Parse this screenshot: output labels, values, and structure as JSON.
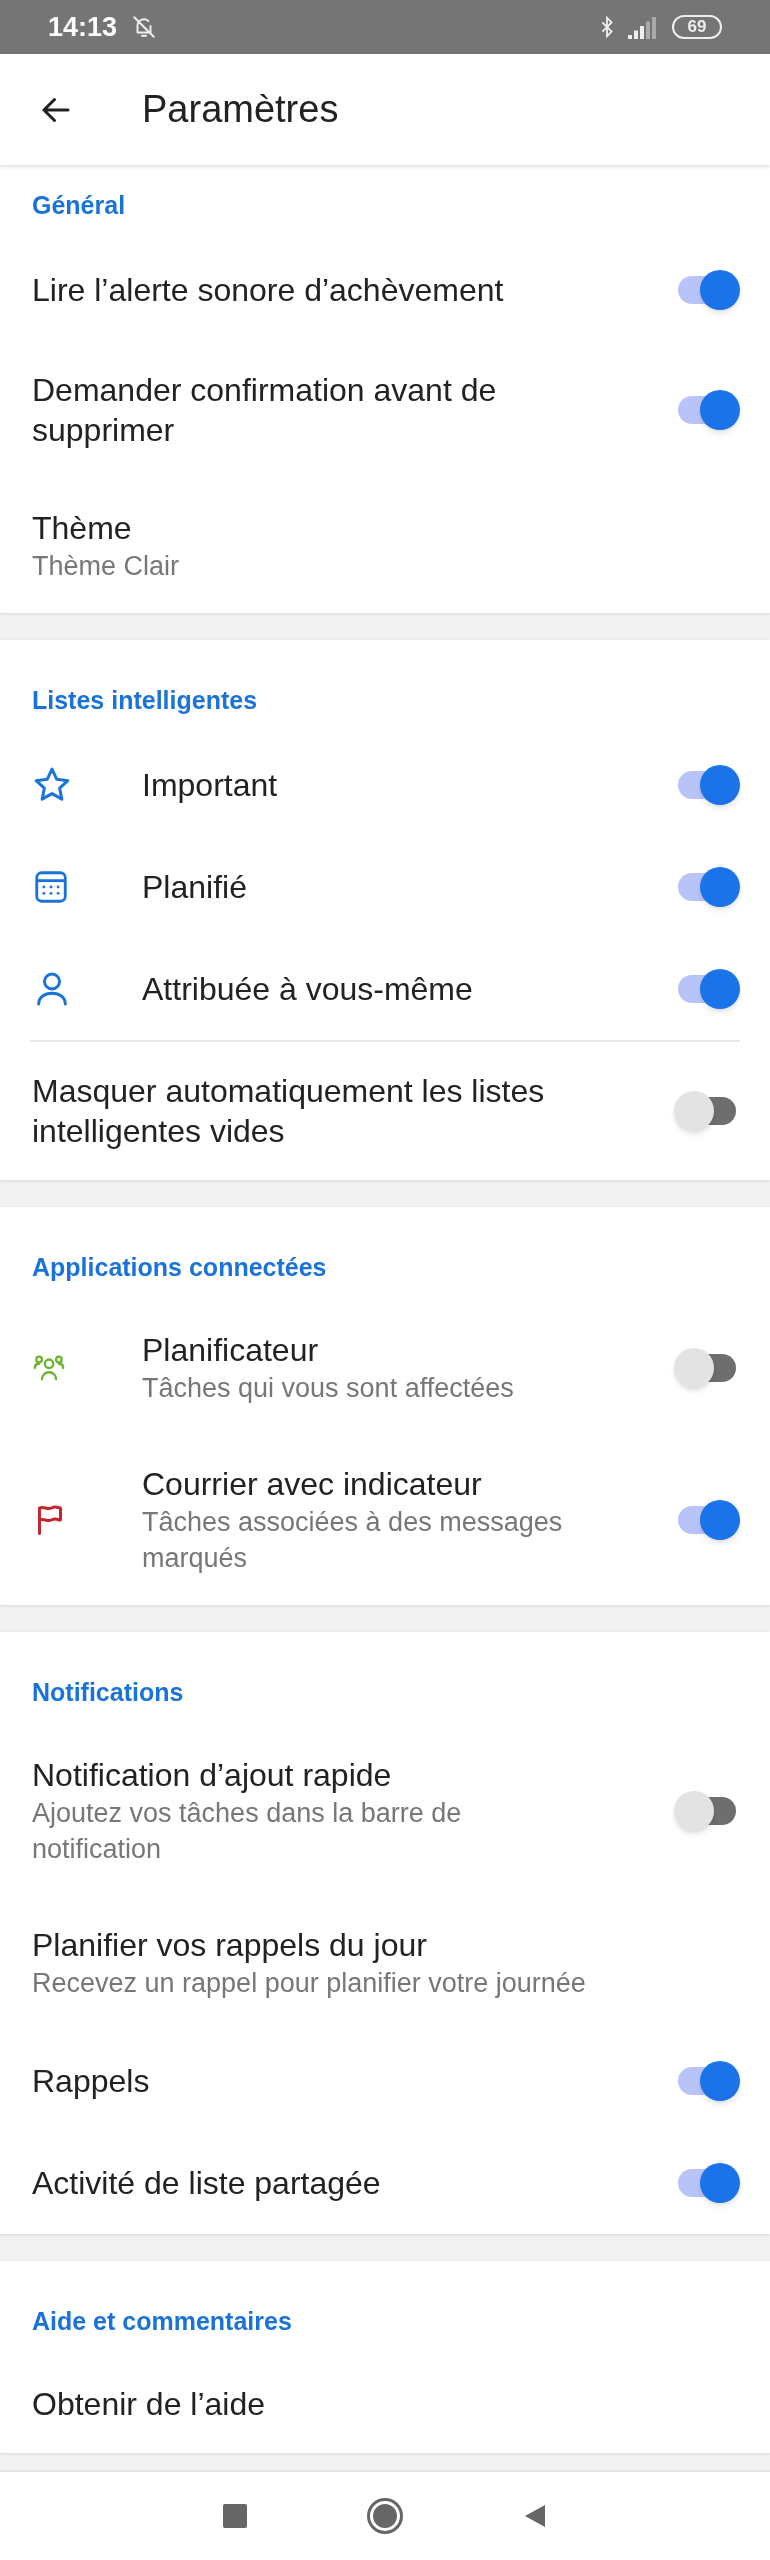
{
  "status_bar": {
    "time": "14:13",
    "battery": "69"
  },
  "app_bar": {
    "title": "Paramètres"
  },
  "sections": [
    {
      "kind": "general",
      "header": "Général",
      "items": [
        {
          "kind": "toggle",
          "title": "Lire l’alerte sonore d’achèvement",
          "on": true
        },
        {
          "kind": "toggle",
          "title": "Demander confirmation avant de supprimer",
          "on": true
        },
        {
          "kind": "text",
          "title": "Thème",
          "subtitle": "Thème Clair"
        }
      ]
    },
    {
      "kind": "smart_lists",
      "header": "Listes intelligentes",
      "items": [
        {
          "kind": "toggle",
          "title": "Important",
          "on": true
        },
        {
          "kind": "toggle",
          "title": "Planifié",
          "on": true
        },
        {
          "kind": "toggle",
          "title": "Attribuée à vous-même",
          "on": true
        },
        {
          "kind": "toggle",
          "title": "Masquer automatiquement les listes intelligentes vides",
          "on": false,
          "divider": true
        }
      ]
    },
    {
      "kind": "apps",
      "header": "Applications connectées",
      "items": [
        {
          "kind": "toggle",
          "title": "Planificateur",
          "subtitle": "Tâches qui vous sont affectées",
          "on": false
        },
        {
          "kind": "toggle",
          "title": "Courrier avec indicateur",
          "subtitle": "Tâches associées à des messages marqués",
          "on": true
        }
      ]
    },
    {
      "kind": "general",
      "header": "Notifications",
      "items": [
        {
          "kind": "toggle",
          "title": "Notification d’ajout rapide",
          "subtitle": "Ajoutez vos tâches dans la barre de notification",
          "on": false
        },
        {
          "kind": "text",
          "title": "Planifier vos rappels du jour",
          "subtitle": "Recevez un rappel pour planifier votre journée"
        },
        {
          "kind": "toggle",
          "title": "Rappels",
          "on": true
        },
        {
          "kind": "toggle",
          "title": "Activité de liste partagée",
          "on": true
        }
      ]
    },
    {
      "kind": "general",
      "header": "Aide et commentaires",
      "items": [
        {
          "kind": "text",
          "title": "Obtenir de l’aide"
        }
      ]
    }
  ]
}
